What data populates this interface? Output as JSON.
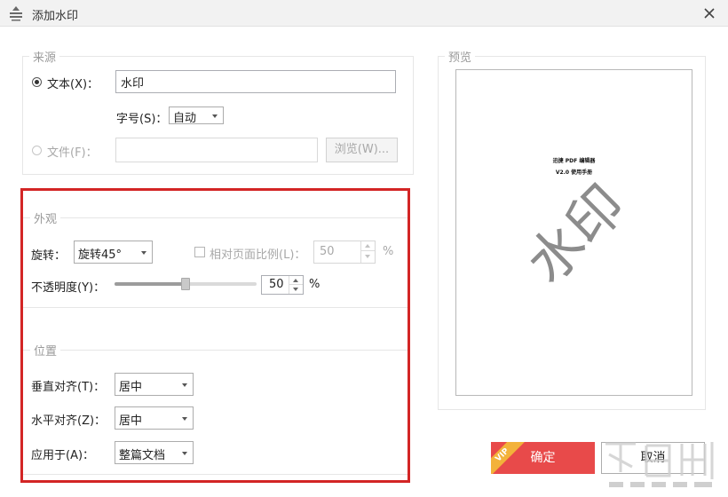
{
  "window": {
    "title": "添加水印"
  },
  "source": {
    "group_title": "来源",
    "text_option": {
      "label": "文本(X)：",
      "value": "水印",
      "selected": true
    },
    "font_size": {
      "label": "字号(S)：",
      "value": "自动"
    },
    "file_option": {
      "label": "文件(F)：",
      "value": "",
      "selected": false
    },
    "browse_label": "浏览(W)..."
  },
  "appearance": {
    "group_title": "外观",
    "rotation": {
      "label": "旋转：",
      "value": "旋转45°"
    },
    "relative_scale": {
      "label": "相对页面比例(L)：",
      "value": "50",
      "unit": "%",
      "checked": false
    },
    "opacity": {
      "label": "不透明度(Y)：",
      "value": "50",
      "unit": "%",
      "slider_percent": 50
    }
  },
  "position": {
    "group_title": "位置",
    "vertical_align": {
      "label": "垂直对齐(T)：",
      "value": "居中"
    },
    "horizontal_align": {
      "label": "水平对齐(Z)：",
      "value": "居中"
    },
    "apply_to": {
      "label": "应用于(A)：",
      "value": "整篇文档"
    }
  },
  "preview": {
    "group_title": "预览",
    "page_line1": "迅捷 PDF 编辑器",
    "page_line2": "V2.0 使用手册",
    "watermark_text": "水印"
  },
  "buttons": {
    "ok": "确定",
    "vip_badge": "VIP",
    "cancel": "取消"
  },
  "colors": {
    "accent_red": "#e84a4a",
    "highlight_red": "#d32525",
    "vip_orange": "#f3b23a"
  }
}
